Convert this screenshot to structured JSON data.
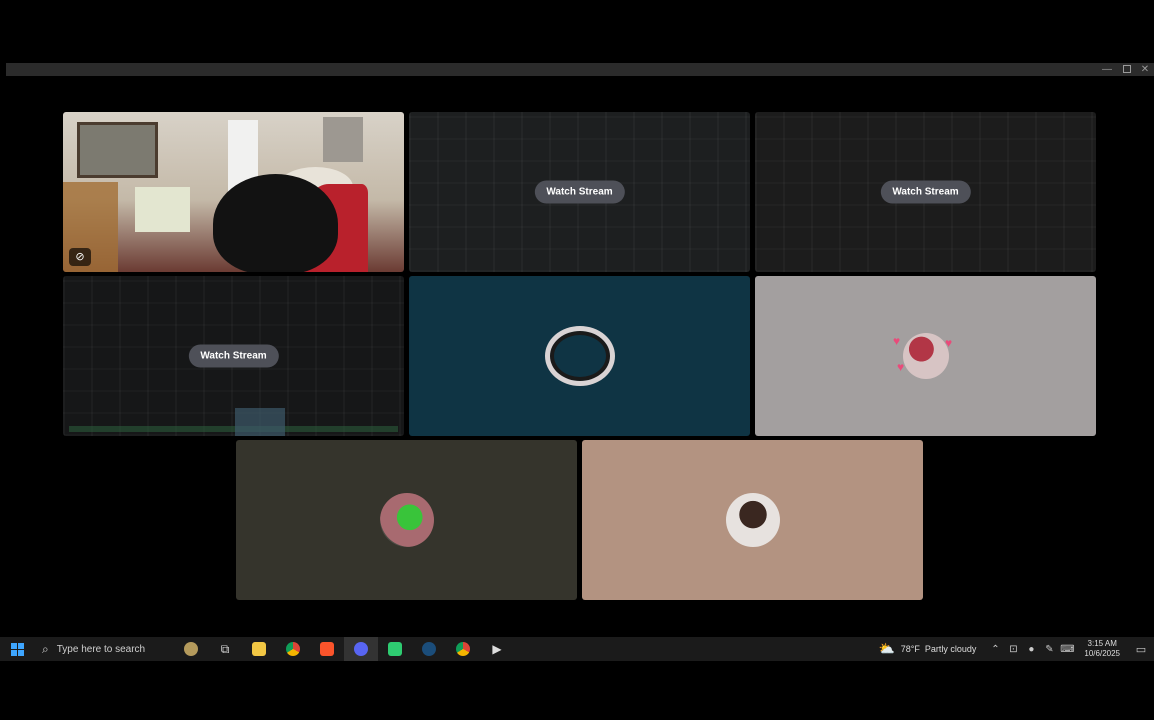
{
  "window": {
    "controls": {
      "minimize": "—",
      "maximize": "",
      "close": "✕"
    }
  },
  "tiles": [
    {
      "id": "camera",
      "type": "camera",
      "badge_icon": "camera-off-icon"
    },
    {
      "id": "stream-1",
      "type": "stream",
      "button": "Watch Stream"
    },
    {
      "id": "stream-2",
      "type": "stream",
      "button": "Watch Stream"
    },
    {
      "id": "stream-3",
      "type": "stream",
      "button": "Watch Stream"
    },
    {
      "id": "avatar-1",
      "type": "avatar",
      "bg": "#0f3444"
    },
    {
      "id": "avatar-2",
      "type": "avatar",
      "bg": "#a39f9f"
    },
    {
      "id": "avatar-3",
      "type": "avatar",
      "bg": "#35342c"
    },
    {
      "id": "avatar-4",
      "type": "avatar",
      "bg": "#b39381"
    }
  ],
  "taskbar": {
    "search_placeholder": "Type here to search",
    "pinned_icons": [
      "news-widget-icon",
      "task-view-icon",
      "file-explorer-icon",
      "chrome-icon",
      "brave-icon",
      "discord-icon",
      "green-app-icon",
      "steam-icon",
      "chrome-profile-icon",
      "media-player-icon"
    ],
    "weather": {
      "temp": "78°F",
      "condition": "Partly cloudy"
    },
    "clock": {
      "time": "3:15 AM",
      "date": "10/6/2025"
    }
  }
}
